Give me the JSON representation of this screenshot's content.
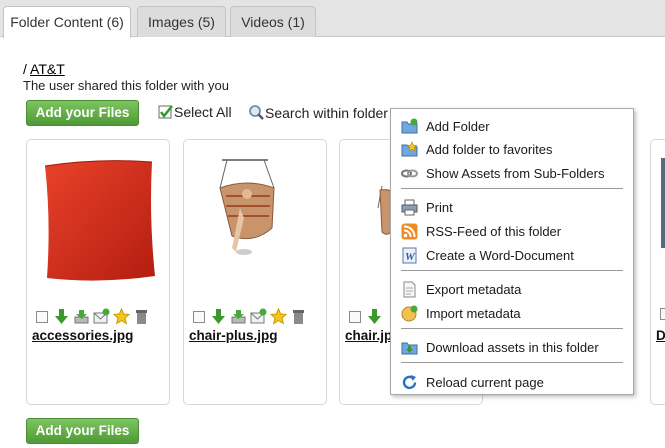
{
  "tabs": [
    {
      "label": "Folder Content (6)"
    },
    {
      "label": "Images (5)"
    },
    {
      "label": "Videos (1)"
    }
  ],
  "breadcrumb": {
    "separator": "/",
    "folder": "AT&T"
  },
  "shared_notice": "The user shared this folder with you",
  "toolbar": {
    "add_files_label": "Add your Files",
    "select_all_label": "Select All",
    "search_label": "Search within folder"
  },
  "files": [
    {
      "name": "accessories.jpg"
    },
    {
      "name": "chair-plus.jpg"
    },
    {
      "name": "chair.jpg"
    },
    {
      "name": "D"
    }
  ],
  "context_menu": {
    "groups": [
      [
        {
          "label": "Add Folder",
          "icon": "folder-add-icon"
        },
        {
          "label": "Add folder to favorites",
          "icon": "folder-star-icon"
        },
        {
          "label": "Show Assets from Sub-Folders",
          "icon": "chain-icon"
        }
      ],
      [
        {
          "label": "Print",
          "icon": "printer-icon"
        },
        {
          "label": "RSS-Feed of this folder",
          "icon": "rss-icon"
        },
        {
          "label": "Create a Word-Document",
          "icon": "word-doc-icon"
        }
      ],
      [
        {
          "label": "Export metadata",
          "icon": "export-doc-icon"
        },
        {
          "label": "Import metadata",
          "icon": "import-icon"
        }
      ],
      [
        {
          "label": "Download assets in this folder",
          "icon": "folder-download-icon"
        }
      ],
      [
        {
          "label": "Reload current page",
          "icon": "reload-icon"
        }
      ]
    ]
  },
  "footer": {
    "add_files_label": "Add your Files"
  },
  "colors": {
    "button_green": "#5aa83f",
    "tab_bg": "#dcdcdc",
    "menu_border": "#a8a8a8"
  }
}
